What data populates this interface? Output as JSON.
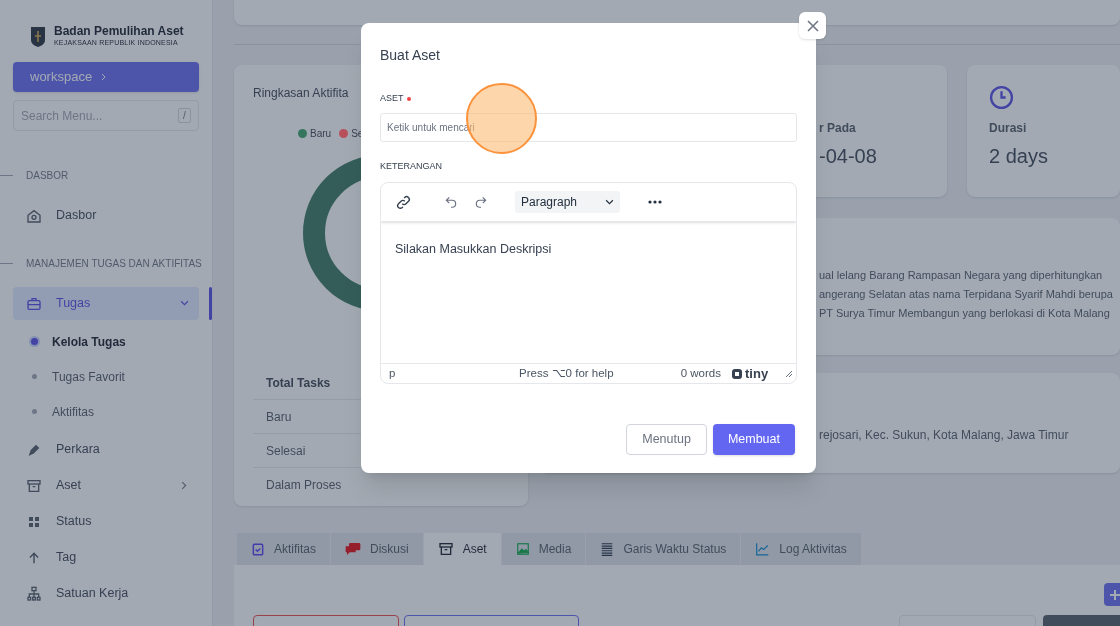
{
  "sidebar": {
    "brand_title": "Badan Pemulihan Aset",
    "brand_subtitle": "KEJAKSAAN REPUBLIK INDONESIA",
    "workspace_button": "workspace",
    "search": {
      "placeholder": "Search Menu...",
      "shortcut": "/"
    },
    "sections": [
      {
        "heading": "DASBOR",
        "items": [
          {
            "label": "Dasbor",
            "selected": false
          }
        ]
      },
      {
        "heading": "MANAJEMEN TUGAS DAN AKTIFITAS",
        "items": [
          {
            "label": "Tugas",
            "selected": true,
            "expanded": true,
            "children": [
              {
                "label": "Kelola Tugas",
                "selected": true
              },
              {
                "label": "Tugas Favorit",
                "selected": false
              },
              {
                "label": "Aktifitas",
                "selected": false
              }
            ]
          },
          {
            "label": "Perkara",
            "selected": false
          },
          {
            "label": "Aset",
            "selected": false,
            "expanded": false
          },
          {
            "label": "Status",
            "selected": false
          },
          {
            "label": "Tag",
            "selected": false
          },
          {
            "label": "Satuan Kerja",
            "selected": false
          }
        ]
      }
    ]
  },
  "summary": {
    "title": "Ringkasan Aktifita",
    "legend": [
      {
        "label": "Baru",
        "color": "#35765f"
      },
      {
        "label": "Se",
        "color": "#b8505c"
      }
    ],
    "table": {
      "header": "Total Tasks",
      "rows": [
        "Baru",
        "Selesai",
        "Dalam Proses"
      ]
    }
  },
  "stats": [
    {
      "kind": "date",
      "label": "r Pada",
      "value": "-04-08"
    },
    {
      "kind": "duration",
      "label": "Durasi",
      "value": "2 days"
    }
  ],
  "description": [
    "ual lelang Barang Rampasan Negara yang diperhitungkan",
    "angerang Selatan atas nama Terpidana Syarif Mahdi berupa",
    "PT Surya Timur Membangun yang berlokasi di Kota Malang"
  ],
  "address": "rejosari, Kec. Sukun, Kota Malang, Jawa Timur",
  "tabs": [
    {
      "label": "Aktifitas",
      "selected": false
    },
    {
      "label": "Diskusi",
      "selected": false
    },
    {
      "label": "Aset",
      "selected": true
    },
    {
      "label": "Media",
      "selected": false
    },
    {
      "label": "Garis Waktu Status",
      "selected": false
    },
    {
      "label": "Log Aktivitas",
      "selected": false
    }
  ],
  "modal": {
    "title": "Buat Aset",
    "fields": [
      {
        "label": "ASET",
        "required": true,
        "placeholder": "Ketik untuk mencari"
      }
    ],
    "editor": {
      "label": "KETERANGAN",
      "format": "Paragraph",
      "content": "Silakan Masukkan Deskripsi",
      "path": "p",
      "help": "Press ⌥0 for help",
      "word_count": "0 words",
      "brand": "tiny"
    },
    "buttons": [
      {
        "label": "Menutup",
        "kind": "secondary"
      },
      {
        "label": "Membuat",
        "kind": "primary"
      }
    ]
  }
}
